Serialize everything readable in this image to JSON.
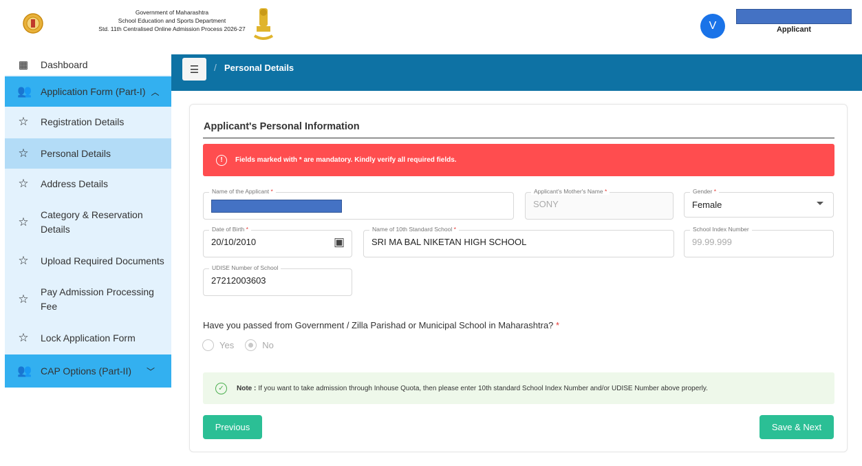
{
  "header": {
    "line1": "Government of Maharashtra",
    "line2": "School Education and Sports Department",
    "line3": "Std. 11th Centralised Online Admission Process 2026-27",
    "avatar_initial": "V",
    "user_role": "Applicant"
  },
  "sidebar": {
    "items": [
      {
        "label": "Dashboard",
        "icon": "dashboard-icon"
      },
      {
        "label": "Application Form (Part-I)",
        "icon": "users-icon",
        "expanded": true
      },
      {
        "label": "Registration Details",
        "icon": "star-icon"
      },
      {
        "label": "Personal Details",
        "icon": "star-icon",
        "active": true
      },
      {
        "label": "Address Details",
        "icon": "star-icon"
      },
      {
        "label": "Category & Reservation Details",
        "icon": "star-icon"
      },
      {
        "label": "Upload Required Documents",
        "icon": "star-icon"
      },
      {
        "label": "Pay Admission Processing Fee",
        "icon": "star-icon"
      },
      {
        "label": "Lock Application Form",
        "icon": "star-icon"
      },
      {
        "label": "CAP Options (Part-II)",
        "icon": "users-icon",
        "expanded": false
      }
    ]
  },
  "breadcrumb": {
    "separator": "/",
    "current": "Personal Details"
  },
  "form": {
    "title": "Applicant's Personal Information",
    "alert": "Fields marked with * are mandatory. Kindly verify all required fields.",
    "applicant_name": {
      "label": "Name of the Applicant",
      "value": ""
    },
    "mother_name": {
      "label": "Applicant's Mother's Name",
      "value": "SONY"
    },
    "gender": {
      "label": "Gender",
      "value": "Female"
    },
    "dob": {
      "label": "Date of Birth",
      "value": "20/10/2010"
    },
    "school_name": {
      "label": "Name of 10th Standard School",
      "value": "SRI MA BAL NIKETAN HIGH SCHOOL"
    },
    "school_index": {
      "label": "School Index Number",
      "placeholder": "99.99.999"
    },
    "udise": {
      "label": "UDISE Number of School",
      "value": "27212003603"
    },
    "question": "Have you passed from Government / Zilla Parishad or Municipal School in Maharashtra?",
    "options": {
      "yes": "Yes",
      "no": "No",
      "selected": "No"
    },
    "note_label": "Note :",
    "note_text": "If you want to take admission through Inhouse Quota, then please enter 10th standard School Index Number and/or UDISE Number above properly.",
    "prev_button": "Previous",
    "next_button": "Save & Next",
    "required_mark": "*"
  },
  "colors": {
    "breadcrumb_bg": "#0e72a4",
    "sidebar_bg": "#e3f2fd",
    "sidebar_group": "#33b0f0",
    "sidebar_active": "#b3dcf7",
    "alert_bg": "#ff4d4f",
    "button": "#2bbf95"
  }
}
